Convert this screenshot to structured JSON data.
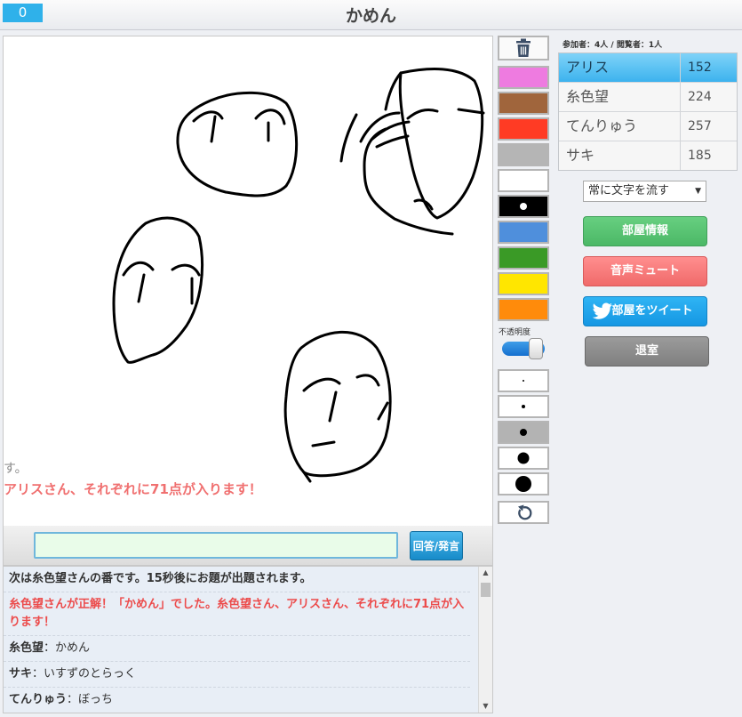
{
  "header": {
    "counter": "0",
    "title": "かめん"
  },
  "canvas": {
    "overlay_line1": "す。",
    "overlay_line2": "アリスさん、それぞれに71点が入ります！"
  },
  "answer": {
    "input_value": "",
    "submit_label": "回答/発言"
  },
  "chat": {
    "messages": [
      {
        "text": "次は糸色望さんの番です。15秒後にお題が出題されます。"
      },
      {
        "text": "糸色望さんが正解！「かめん」でした。糸色望さん、アリスさん、それぞれに71点が入ります！"
      },
      {
        "speaker": "糸色望",
        "sep": "：",
        "text": "かめん"
      },
      {
        "speaker": "サキ",
        "sep": "：",
        "text": "いすずのとらっく"
      },
      {
        "speaker": "てんりゅう",
        "sep": "：",
        "text": "ぼっち"
      }
    ]
  },
  "tools": {
    "trash_icon": "trash-icon",
    "colors": [
      "#ee7be0",
      "#a0653c",
      "#ff3b24",
      "#b5b5b5",
      "#ffffff",
      "#000000",
      "#4f8fdc",
      "#3a9a26",
      "#ffe600",
      "#ff8b0b"
    ],
    "selected_color_index": 5,
    "opacity_label": "不透明度",
    "opacity_value": 0.75,
    "brush_sizes": [
      2,
      4,
      8,
      13,
      18
    ],
    "selected_size_index": 2,
    "undo_icon": "undo-icon"
  },
  "room": {
    "participants": "参加者：4人 / 閲覧者：1人",
    "players": [
      {
        "name": "アリス",
        "score": "152",
        "active": true
      },
      {
        "name": "糸色望",
        "score": "224"
      },
      {
        "name": "てんりゅう",
        "score": "257"
      },
      {
        "name": "サキ",
        "score": "185"
      }
    ],
    "text_mode": "常に文字を流す",
    "buttons": {
      "info": "部屋情報",
      "mute": "音声ミュート",
      "tweet": "部屋をツイート",
      "exit": "退室"
    }
  }
}
